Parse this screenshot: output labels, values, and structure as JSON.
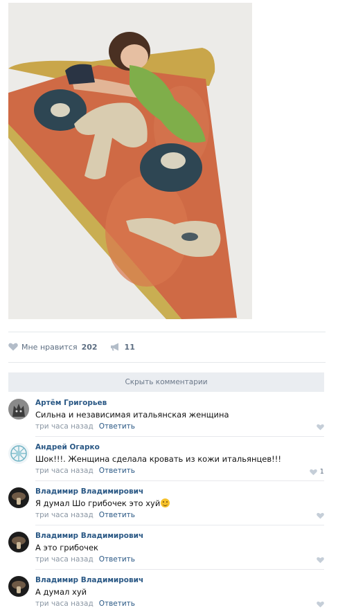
{
  "post": {
    "image_alt": "pizza slice sleeping bag",
    "likes_label": "Мне нравится",
    "likes_count": "202",
    "shares_count": "11"
  },
  "comments_toggle": "Скрыть комментарии",
  "comments": [
    {
      "author": "Артём Григорьев",
      "text": "Сильна и независимая итальянская женщина",
      "time": "три часа назад",
      "reply": "Ответить",
      "likes": ""
    },
    {
      "author": "Андрей Огарко",
      "text": "Шок!!!. Женщина сделала кровать из кожи итальянцев!!!",
      "time": "три часа назад",
      "reply": "Ответить",
      "likes": "1"
    },
    {
      "author": "Владимир Владимирович",
      "text": "Я думал Шо грибочек это хуй",
      "time": "три часа назад",
      "reply": "Ответить",
      "likes": ""
    },
    {
      "author": "Владимир Владимирович",
      "text": "А это грибочек",
      "time": "три часа назад",
      "reply": "Ответить",
      "likes": ""
    },
    {
      "author": "Владимир Владимирович",
      "text": "А думал хуй",
      "time": "три часа назад",
      "reply": "Ответить",
      "likes": ""
    }
  ],
  "colors": {
    "link": "#2a5885",
    "meta": "#8a96a3",
    "accent_bg": "#eaedf1"
  }
}
